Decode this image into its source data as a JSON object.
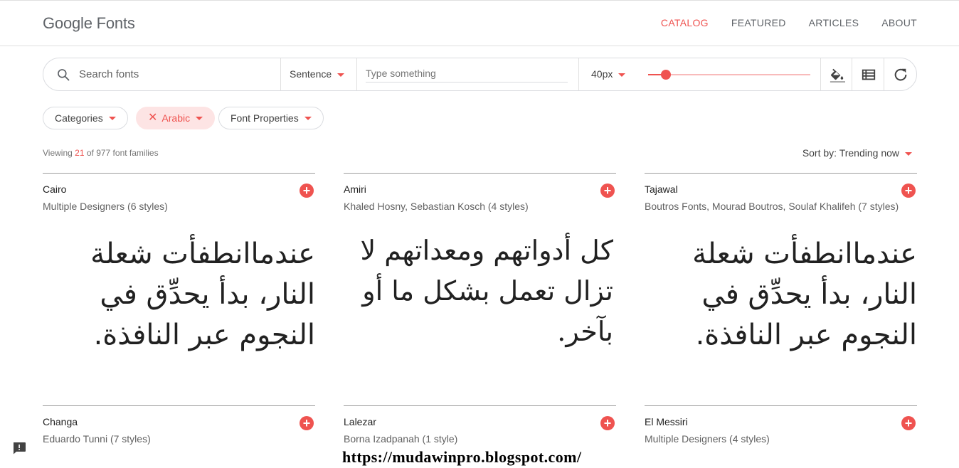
{
  "header": {
    "logo": "Google Fonts",
    "nav": [
      "CATALOG",
      "FEATURED",
      "ARTICLES",
      "ABOUT"
    ],
    "active_nav": "CATALOG"
  },
  "toolbar": {
    "search_placeholder": "Search fonts",
    "preview_mode": "Sentence",
    "type_placeholder": "Type something",
    "font_size": "40px",
    "font_size_fraction": 0.11,
    "icons": [
      "search-icon",
      "paint-bucket-icon",
      "list-view-icon",
      "refresh-icon"
    ]
  },
  "filters": {
    "categories": "Categories",
    "language": "Arabic",
    "properties": "Font Properties"
  },
  "results": {
    "prefix": "Viewing",
    "count": "21",
    "suffix": "of 977 font families",
    "sort_label": "Sort by: Trending now"
  },
  "cards": [
    {
      "name": "Cairo",
      "designer": "Multiple Designers (6 styles)",
      "sample": "عندماانطفأت شعلة النار، بدأ يحدِّق في النجوم عبر النافذة."
    },
    {
      "name": "Amiri",
      "designer": "Khaled Hosny, Sebastian Kosch (4 styles)",
      "sample": "كل أدواتهم ومعداتهم لا تزال تعمل بشكل ما أو بآخر."
    },
    {
      "name": "Tajawal",
      "designer": "Boutros Fonts, Mourad Boutros, Soulaf Khalifeh (7 styles)",
      "sample": "عندماانطفأت شعلة النار، بدأ يحدِّق في النجوم عبر النافذة."
    },
    {
      "name": "Changa",
      "designer": "Eduardo Tunni (7 styles)",
      "sample": ""
    },
    {
      "name": "Lalezar",
      "designer": "Borna Izadpanah (1 style)",
      "sample": ""
    },
    {
      "name": "El Messiri",
      "designer": "Multiple Designers (4 styles)",
      "sample": ""
    }
  ],
  "watermark": "https://mudawinpro.blogspot.com/",
  "colors": {
    "accent": "#ef5350"
  }
}
